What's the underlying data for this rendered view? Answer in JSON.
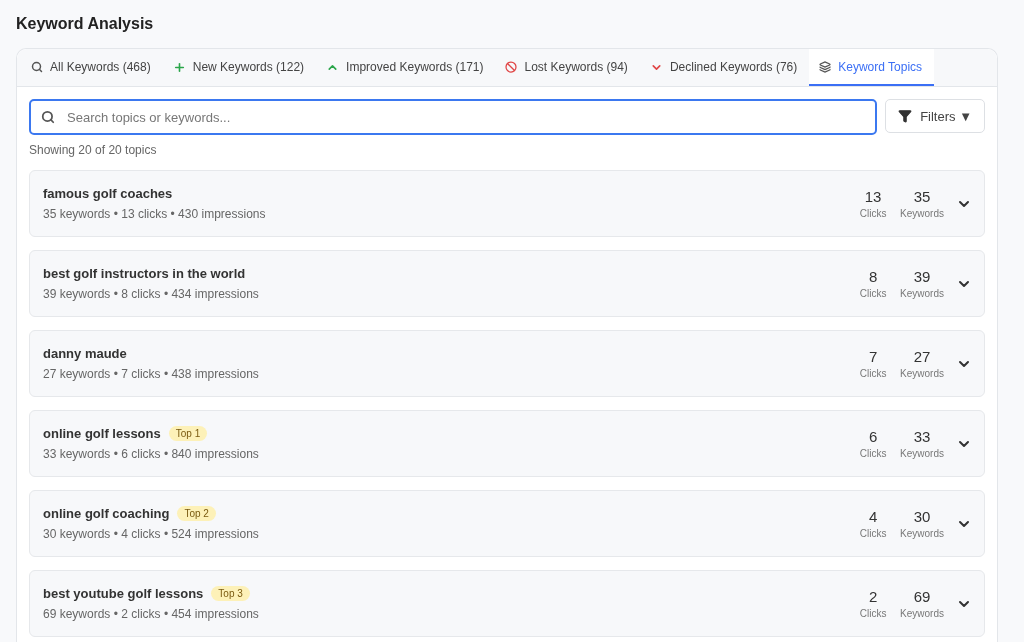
{
  "title": "Keyword Analysis",
  "tabs": [
    {
      "label": "All Keywords (468)",
      "kind": "search",
      "selected": false
    },
    {
      "label": "New Keywords (122)",
      "kind": "new",
      "selected": false
    },
    {
      "label": "Improved Keywords (171)",
      "kind": "improved",
      "selected": false
    },
    {
      "label": "Lost Keywords (94)",
      "kind": "lost",
      "selected": false
    },
    {
      "label": "Declined Keywords (76)",
      "kind": "declined",
      "selected": false
    },
    {
      "label": "Keyword Topics",
      "kind": "topics",
      "selected": true
    }
  ],
  "search": {
    "placeholder": "Search topics or keywords..."
  },
  "filters_button": {
    "label": "Filters ▼"
  },
  "summary": "Showing 20 of 20 topics",
  "topics": [
    {
      "name": "famous golf coaches",
      "details": "35 keywords • 13 clicks • 430 impressions",
      "clicks": "13",
      "clicks_label": "Clicks",
      "keywords": "35",
      "keywords_label": "Keywords",
      "expanded": false
    },
    {
      "name": "best golf instructors in the world",
      "details": "39 keywords • 8 clicks • 434 impressions",
      "clicks": "8",
      "clicks_label": "Clicks",
      "keywords": "39",
      "keywords_label": "Keywords",
      "expanded": false
    },
    {
      "name": "danny maude",
      "details": "27 keywords • 7 clicks • 438 impressions",
      "clicks": "7",
      "clicks_label": "Clicks",
      "keywords": "27",
      "keywords_label": "Keywords",
      "expanded": false
    },
    {
      "name": "online golf lessons",
      "badge": "Top 1",
      "details": "33 keywords • 6 clicks • 840 impressions",
      "clicks": "6",
      "clicks_label": "Clicks",
      "keywords": "33",
      "keywords_label": "Keywords",
      "expanded": false
    },
    {
      "name": "online golf coaching",
      "badge": "Top 2",
      "details": "30 keywords • 4 clicks • 524 impressions",
      "clicks": "4",
      "clicks_label": "Clicks",
      "keywords": "30",
      "keywords_label": "Keywords",
      "expanded": false
    },
    {
      "name": "best youtube golf lessons",
      "badge": "Top 3",
      "details": "69 keywords • 2 clicks • 454 impressions",
      "clicks": "2",
      "clicks_label": "Clicks",
      "keywords": "69",
      "keywords_label": "Keywords",
      "expanded": false
    }
  ]
}
